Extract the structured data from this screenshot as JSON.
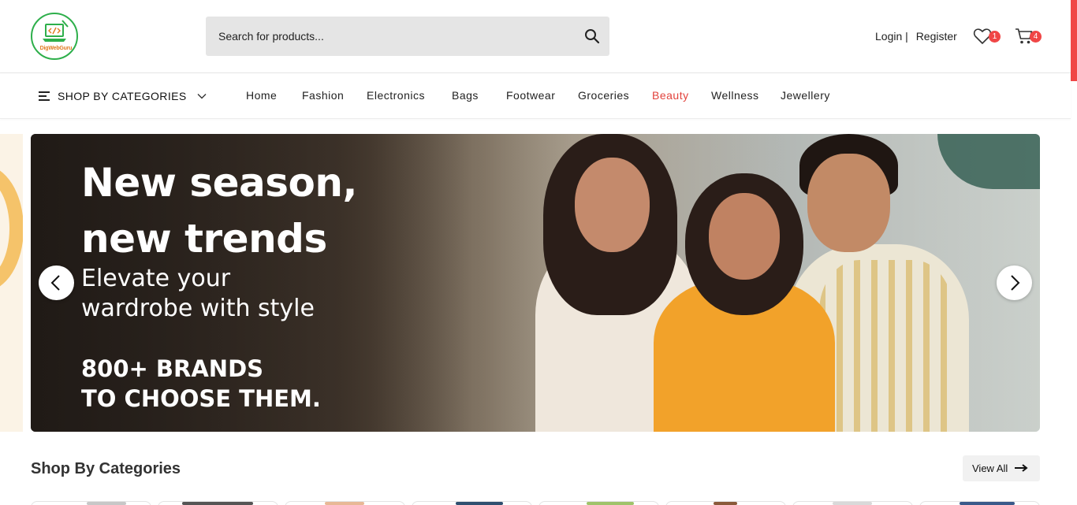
{
  "header": {
    "logo_text": "DigWebGuru",
    "search": {
      "placeholder": "Search for products..."
    },
    "login_label": "Login",
    "separator": "|",
    "register_label": "Register",
    "wishlist_count": "1",
    "cart_count": "4"
  },
  "nav": {
    "categories_label": "SHOP BY CATEGORIES",
    "items": [
      "Home",
      "Fashion",
      "Electronics",
      "Bags",
      "Footwear",
      "Groceries",
      "Beauty",
      "Wellness",
      "Jewellery"
    ],
    "active": "Beauty"
  },
  "banner": {
    "line1": "New season,",
    "line2": "new trends",
    "line3": "Elevate your",
    "line4": "wardrobe with style",
    "line5": "800+ BRANDS",
    "line6": "TO CHOOSE THEM."
  },
  "section": {
    "title": "Shop By Categories",
    "view_all_label": "View All"
  },
  "colors": {
    "accent": "#f04646",
    "active_nav": "#e2423c",
    "logo_ring": "#2eaf4b"
  },
  "icons": [
    "search-icon",
    "heart-icon",
    "cart-icon",
    "menu-icon",
    "chevron-down-icon",
    "chevron-left-icon",
    "chevron-right-icon",
    "arrow-right-icon"
  ]
}
